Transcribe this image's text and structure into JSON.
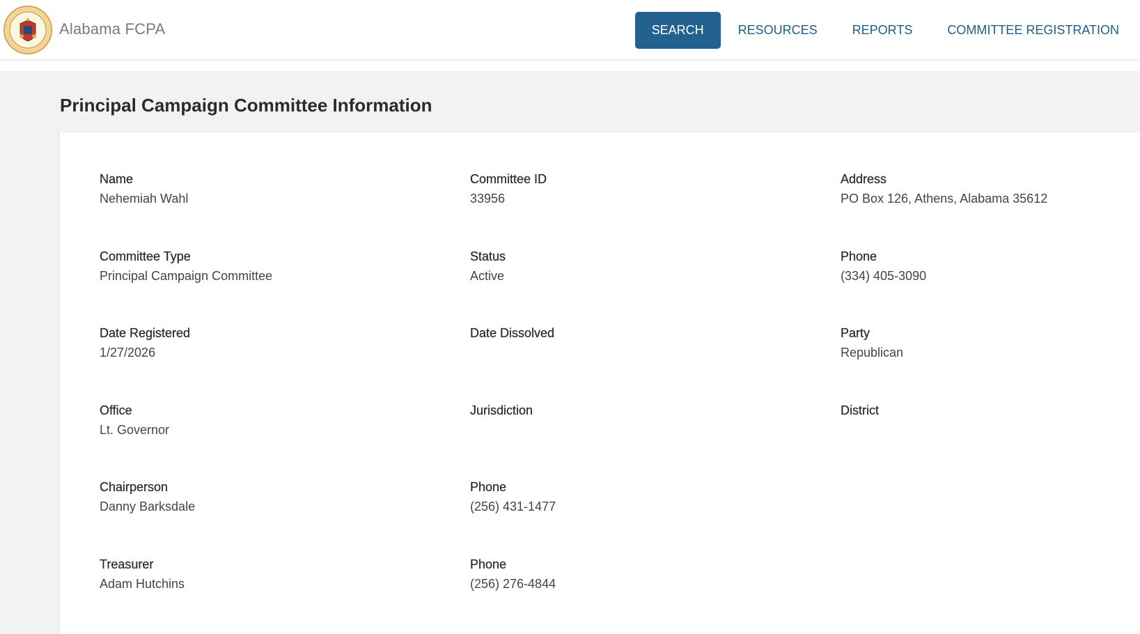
{
  "header": {
    "brand": "Alabama FCPA",
    "logo_icon": "alabama-secretary-of-state-seal",
    "logo_text": "ALABAMA · SECRETARY OF STATE",
    "nav": [
      {
        "label": "SEARCH",
        "active": true
      },
      {
        "label": "RESOURCES",
        "active": false
      },
      {
        "label": "REPORTS",
        "active": false
      },
      {
        "label": "COMMITTEE REGISTRATION",
        "active": false
      }
    ],
    "accent_color": "#23628f"
  },
  "page": {
    "title": "Principal Campaign Committee Information"
  },
  "committee": {
    "rows": [
      [
        {
          "label": "Name",
          "value": "Nehemiah Wahl"
        },
        {
          "label": "Committee ID",
          "value": "33956"
        },
        {
          "label": "Address",
          "value": "PO Box 126, Athens, Alabama 35612"
        }
      ],
      [
        {
          "label": "Committee Type",
          "value": "Principal Campaign Committee"
        },
        {
          "label": "Status",
          "value": "Active"
        },
        {
          "label": "Phone",
          "value": "(334) 405-3090"
        }
      ],
      [
        {
          "label": "Date Registered",
          "value": "1/27/2026"
        },
        {
          "label": "Date Dissolved",
          "value": ""
        },
        {
          "label": "Party",
          "value": "Republican"
        }
      ],
      [
        {
          "label": "Office",
          "value": "Lt. Governor"
        },
        {
          "label": "Jurisdiction",
          "value": ""
        },
        {
          "label": "District",
          "value": ""
        }
      ],
      [
        {
          "label": "Chairperson",
          "value": "Danny Barksdale"
        },
        {
          "label": "Phone",
          "value": "(256) 431-1477"
        }
      ],
      [
        {
          "label": "Treasurer",
          "value": "Adam Hutchins"
        },
        {
          "label": "Phone",
          "value": "(256) 276-4844"
        }
      ]
    ]
  }
}
